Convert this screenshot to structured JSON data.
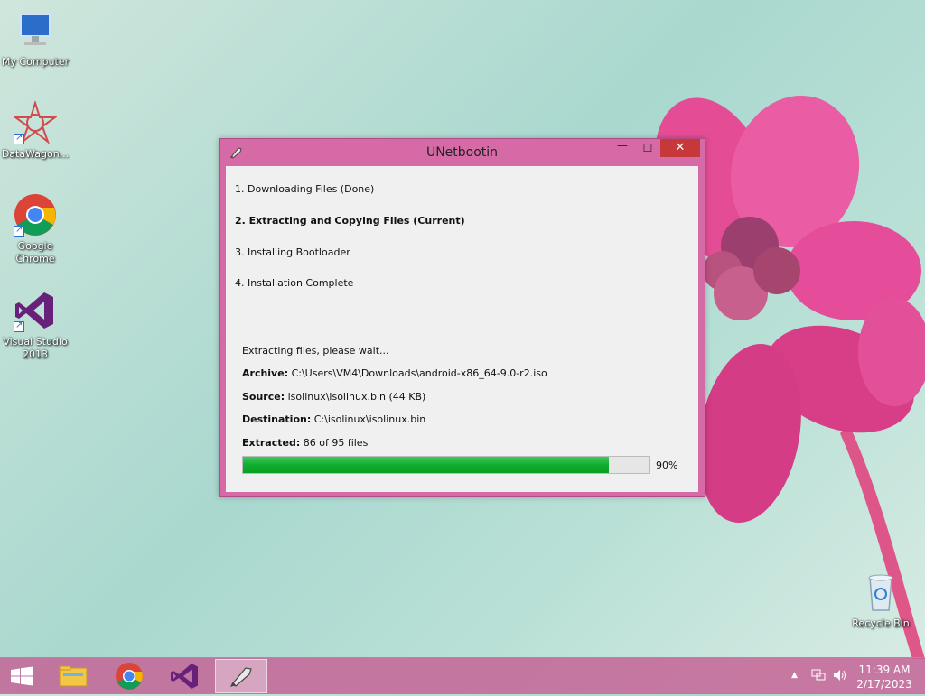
{
  "desktop": {
    "icons": [
      {
        "label": "My Computer"
      },
      {
        "label": "DataWagon..."
      },
      {
        "label": "Google Chrome"
      },
      {
        "label": "Visual Studio 2013"
      },
      {
        "label": "Recycle Bin"
      }
    ]
  },
  "window": {
    "title": "UNetbootin",
    "close_label": "✕",
    "minimize_label": "—",
    "maximize_label": "☐",
    "steps": [
      {
        "label": "1. Downloading Files (Done)",
        "current": false
      },
      {
        "label": "2. Extracting and Copying Files (Current)",
        "current": true
      },
      {
        "label": "3. Installing Bootloader",
        "current": false
      },
      {
        "label": "4. Installation Complete",
        "current": false
      }
    ],
    "status": "Extracting files, please wait...",
    "archive_label": "Archive:",
    "archive_value": "C:\\Users\\VM4\\Downloads\\android-x86_64-9.0-r2.iso",
    "source_label": "Source:",
    "source_value": "isolinux\\isolinux.bin (44 KB)",
    "destination_label": "Destination:",
    "destination_value": "C:\\isolinux\\isolinux.bin",
    "extracted_label": "Extracted:",
    "extracted_value": "86 of 95 files",
    "progress_percent": 90,
    "progress_text": "90%"
  },
  "taskbar": {
    "items": [
      {
        "icon": "windows-start-icon"
      },
      {
        "icon": "file-explorer-icon"
      },
      {
        "icon": "chrome-icon"
      },
      {
        "icon": "visual-studio-icon"
      },
      {
        "icon": "unetbootin-icon",
        "active": true
      }
    ],
    "clock_time": "11:39 AM",
    "clock_date": "2/17/2023"
  },
  "colors": {
    "window_frame": "#d66aa6",
    "close_button": "#c7383a",
    "progress_fill": "#11ac2f"
  }
}
